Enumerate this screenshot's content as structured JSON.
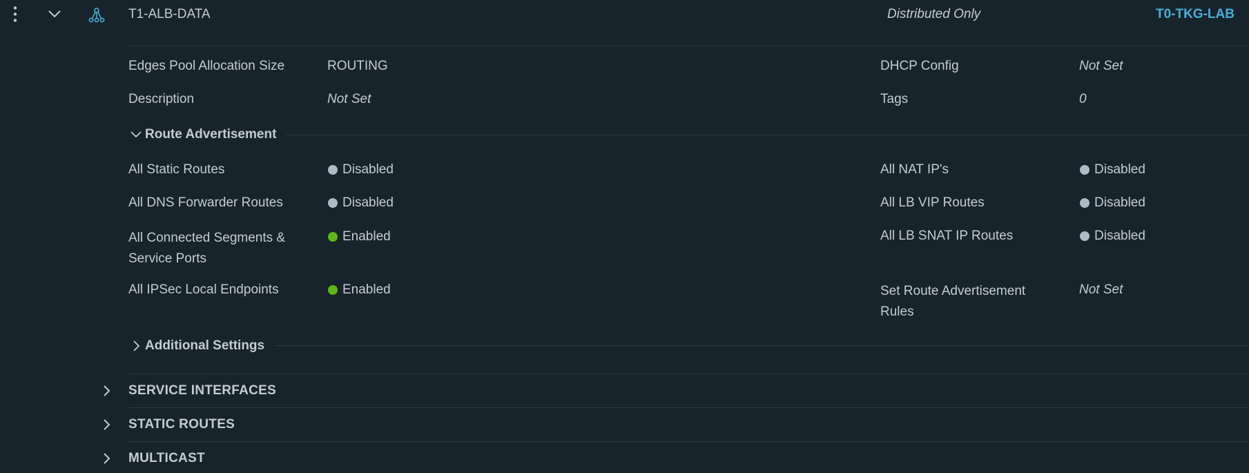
{
  "row": {
    "name": "T1-ALB-DATA",
    "ha_mode": "Distributed Only",
    "linked_tier0": "T0-TKG-LAB"
  },
  "details": {
    "edges_pool_label": "Edges Pool Allocation Size",
    "edges_pool_value": "ROUTING",
    "description_label": "Description",
    "description_value": "Not Set",
    "dhcp_label": "DHCP Config",
    "dhcp_value": "Not Set",
    "tags_label": "Tags",
    "tags_value": "0"
  },
  "route_advertisement": {
    "title": "Route Advertisement",
    "items": [
      {
        "label": "All Static Routes",
        "status": "Disabled"
      },
      {
        "label": "All DNS Forwarder Routes",
        "status": "Disabled"
      },
      {
        "label_line1": "All Connected Segments &",
        "label_line2": "Service Ports",
        "status": "Enabled"
      },
      {
        "label": "All IPSec Local Endpoints",
        "status": "Enabled"
      },
      {
        "label": "All NAT IP's",
        "status": "Disabled"
      },
      {
        "label": "All LB VIP Routes",
        "status": "Disabled"
      },
      {
        "label": "All LB SNAT IP Routes",
        "status": "Disabled"
      },
      {
        "label_line1": "Set Route Advertisement",
        "label_line2": "Rules",
        "value": "Not Set"
      }
    ]
  },
  "additional_settings": {
    "title": "Additional Settings"
  },
  "sections": [
    {
      "title": "SERVICE INTERFACES"
    },
    {
      "title": "STATIC ROUTES"
    },
    {
      "title": "MULTICAST"
    }
  ],
  "colors": {
    "background": "#17242b",
    "enabled": "#5eb715",
    "disabled": "#adbbc4",
    "link": "#49afd9"
  },
  "icons": {
    "row_menu": "vertical-ellipsis-icon",
    "row_expand": "chevron-down-icon",
    "router": "tier1-gateway-icon",
    "section_expand": "chevron-right-icon"
  }
}
